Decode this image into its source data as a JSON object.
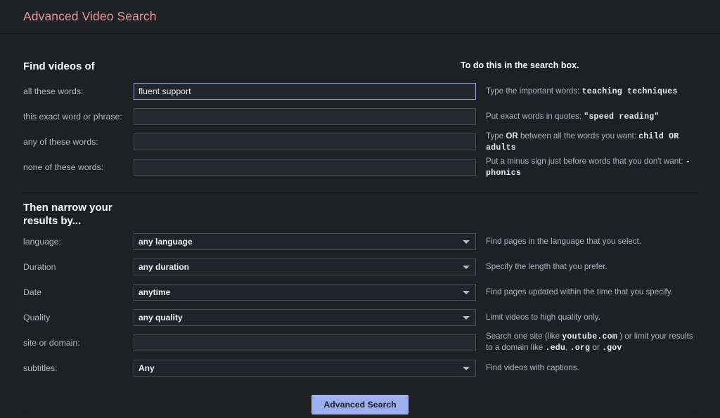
{
  "header": {
    "title": "Advanced Video Search"
  },
  "sections": {
    "find": {
      "title": "Find videos of",
      "hint_header": "To do this in the search box."
    },
    "narrow": {
      "title": "Then narrow your results by..."
    }
  },
  "find_fields": [
    {
      "label": "all these words:",
      "value": "fluent support",
      "placeholder": "",
      "focused": true,
      "hint_prefix": "Type the important words: ",
      "hint_code": "teaching techniques",
      "hint_suffix": ""
    },
    {
      "label": "this exact word or phrase:",
      "value": "",
      "placeholder": "",
      "focused": false,
      "hint_prefix": "Put exact words in quotes: ",
      "hint_code": "\"speed reading\"",
      "hint_suffix": ""
    },
    {
      "label": "any of these words:",
      "value": "",
      "placeholder": "",
      "focused": false,
      "hint_prefix": "Type ",
      "hint_bold": "OR",
      "hint_mid": " between all the words you want: ",
      "hint_code": "child OR adults",
      "hint_suffix": ""
    },
    {
      "label": "none of these words:",
      "value": "",
      "placeholder": "",
      "focused": false,
      "hint_prefix": "Put a minus sign just before words that you don't want: ",
      "hint_code": "-phonics",
      "hint_suffix": ""
    }
  ],
  "narrow_fields": [
    {
      "label": "language:",
      "type": "select",
      "value": "any language",
      "hint": "Find pages in the language that you select."
    },
    {
      "label": "Duration",
      "type": "select",
      "value": "any duration",
      "hint": "Specify the length that you prefer."
    },
    {
      "label": "Date",
      "type": "select",
      "value": "anytime",
      "hint": "Find pages updated within the time that you specify."
    },
    {
      "label": "Quality",
      "type": "select",
      "value": "any quality",
      "hint": "Limit videos to high quality only."
    },
    {
      "label": "site or domain:",
      "type": "text",
      "value": "",
      "placeholder": "",
      "hint_parts": {
        "p1": "Search one site (like ",
        "c1": "youtube.com",
        "p2": " ) or limit your results to a domain like ",
        "c2": ".edu",
        "p3": ", ",
        "c3": ".org",
        "p4": " or ",
        "c4": ".gov"
      }
    },
    {
      "label": "subtitles:",
      "type": "select",
      "value": "Any",
      "hint": "Find videos with captions."
    }
  ],
  "submit": {
    "label": "Advanced Search"
  },
  "icons": {
    "dropdown": "chevron-down-icon"
  },
  "colors": {
    "page_background": "#1e2024",
    "header_background": "#202226",
    "title": "#e49898",
    "button": "#9db0ee",
    "button_text": "#1b1d22",
    "focus_border": "#9aa6d4"
  }
}
